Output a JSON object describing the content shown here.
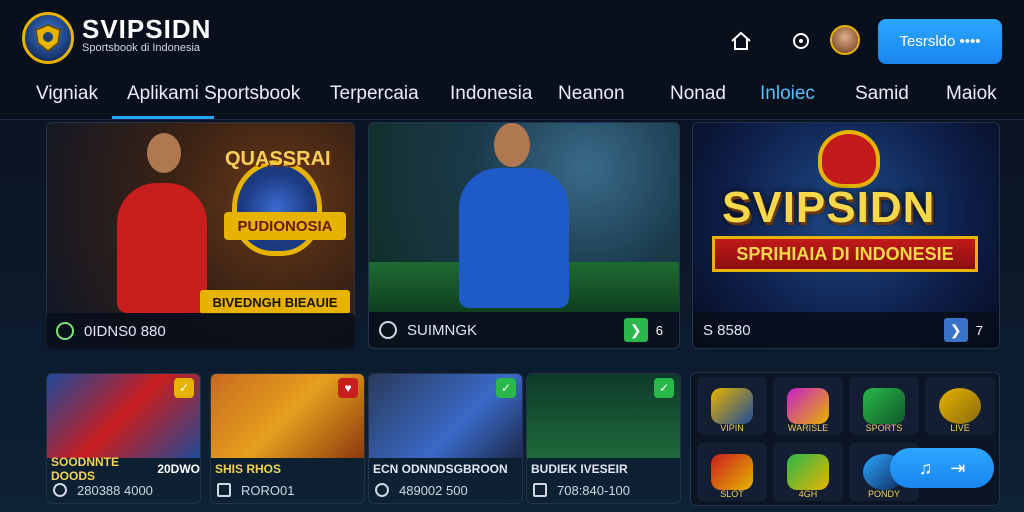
{
  "header": {
    "brand": "SVIPSIDN",
    "brand_sub": "Sportsbook di Indonesia",
    "cta_label": "Tesrsldo ••••"
  },
  "nav": {
    "items": [
      "Vigniak",
      "Aplikami Sportsbook",
      "Terpercaia",
      "Indonesia",
      "Neanon",
      "Nonad",
      "Inloiec",
      "Samid",
      "Maiok"
    ],
    "active_index": 6
  },
  "featured": [
    {
      "title": "QUASSRAI",
      "banner": "PUDIONOSIA",
      "caption": "BIVEDNGH BIEAUIE",
      "footer": "0IDNS0 880"
    },
    {
      "footer": "SUIMNGK",
      "chip": "6"
    },
    {
      "title": "SVIPSIDN",
      "banner": "SPRIHIAIA DI INDONESIE",
      "footer": "S 8580",
      "chip": "7"
    }
  ],
  "small_cards": [
    {
      "label": "SOODNNTE DOODS",
      "label_extra": "20DWO",
      "meta": "280388 4000"
    },
    {
      "label": "SHIS RHOS",
      "meta": "RORO01"
    },
    {
      "label": "ECN ODNNDSGBROON",
      "meta": "489002 500"
    },
    {
      "label": "BUDIEK IVESEIR",
      "meta": "708:840-100"
    }
  ],
  "games": [
    {
      "label": "VIPIN"
    },
    {
      "label": "WARISLE"
    },
    {
      "label": "SPORTS"
    },
    {
      "label": "LIVE"
    },
    {
      "label": "SLOT"
    },
    {
      "label": "4GH"
    },
    {
      "label": "PONDY"
    }
  ],
  "colors": {
    "accent": "#2ba6ff",
    "gold": "#e6b400",
    "green": "#2bb84a"
  }
}
